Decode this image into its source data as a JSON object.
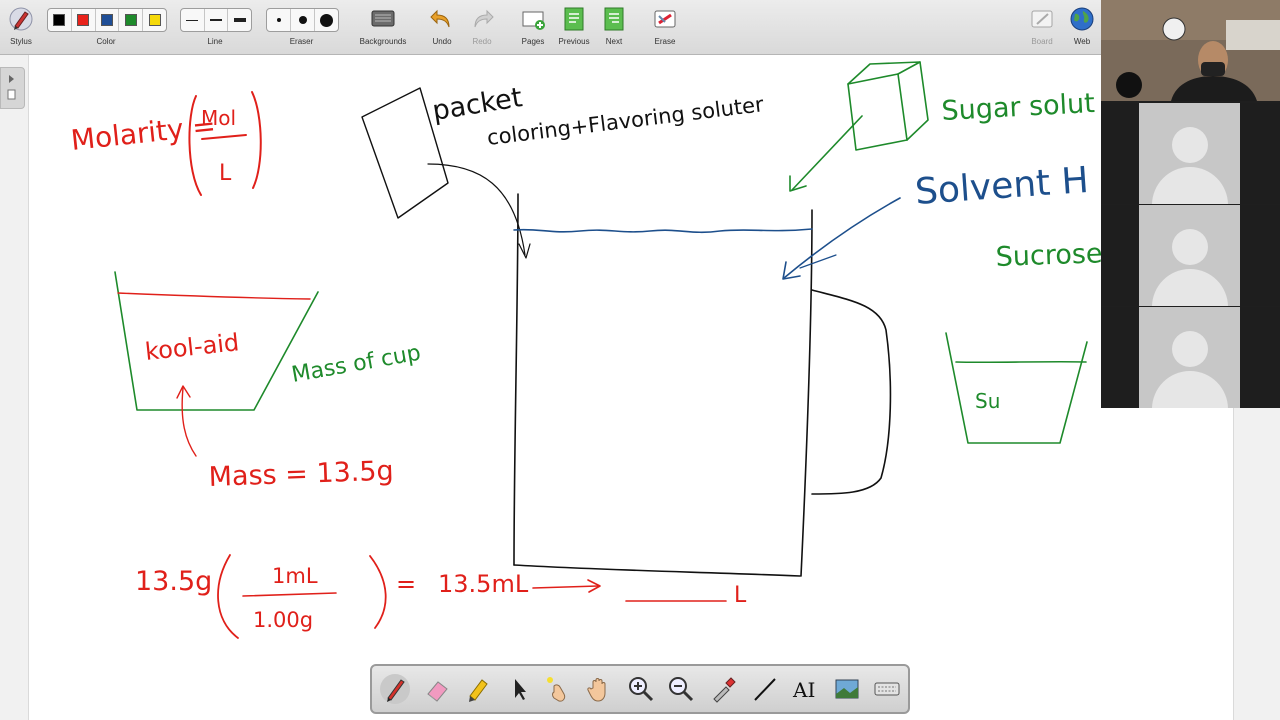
{
  "toolbar": {
    "stylus_label": "Stylus",
    "color_label": "Color",
    "line_label": "Line",
    "eraser_label": "Eraser",
    "backgrounds_label": "Backgrounds",
    "undo_label": "Undo",
    "redo_label": "Redo",
    "pages_label": "Pages",
    "previous_label": "Previous",
    "next_label": "Next",
    "erase_label": "Erase",
    "board_label": "Board",
    "web_label": "Web",
    "colors": [
      "#000000",
      "#e8221b",
      "#1f4e96",
      "#1e8a2b",
      "#f5d90a"
    ]
  },
  "whiteboard": {
    "molarity": "Molarity =",
    "mol": "Mol",
    "liter": "L",
    "packet": "packet",
    "coloring": "coloring+Flavoring soluter",
    "sugar": "Sugar solut",
    "solvent": "Solvent H",
    "sucrose": "Sucrose",
    "koolaid": "kool-aid",
    "mass_of_cup": "Mass of cup",
    "mass": "Mass = 13.5g",
    "calc_left": "13.5g",
    "calc_num": "1mL",
    "calc_den": "1.00g",
    "calc_eq": "=",
    "calc_result": "13.5mL",
    "liters_unit": "L",
    "su": "Su"
  },
  "palette": {
    "tools": [
      "pen-icon",
      "eraser-icon",
      "highlighter-icon",
      "pointer-icon",
      "laser-icon",
      "hand-icon",
      "zoom-in-icon",
      "zoom-out-icon",
      "dropper-icon",
      "line-icon",
      "text-icon",
      "image-icon",
      "keyboard-icon"
    ]
  }
}
